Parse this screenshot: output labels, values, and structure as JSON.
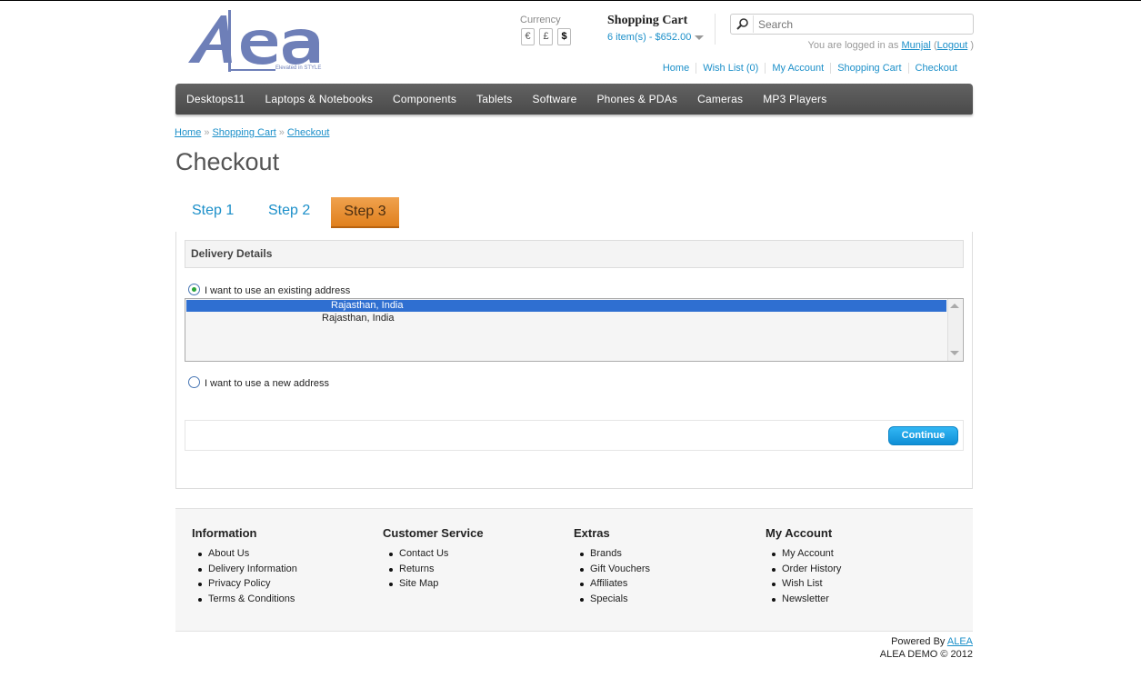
{
  "logo": {
    "text": "Aea",
    "tagline": "Elevated in STYLE"
  },
  "currency": {
    "label": "Currency",
    "options": [
      "€",
      "£",
      "$"
    ],
    "selected": "$"
  },
  "cart": {
    "title": "Shopping Cart",
    "summary": "6 item(s) - $652.00"
  },
  "search": {
    "placeholder": "Search"
  },
  "account": {
    "prefix": "You are logged in as",
    "user": "Munjal",
    "logout": "Logout",
    "open_paren": "(",
    "close_paren": ")"
  },
  "top_links": [
    "Home",
    "Wish List (0)",
    "My Account",
    "Shopping Cart",
    "Checkout"
  ],
  "menu": [
    "Desktops11",
    "Laptops & Notebooks",
    "Components",
    "Tablets",
    "Software",
    "Phones & PDAs",
    "Cameras",
    "MP3 Players"
  ],
  "breadcrumb": {
    "items": [
      "Home",
      "Shopping Cart",
      "Checkout"
    ],
    "separator": "»"
  },
  "page_title": "Checkout",
  "steps": [
    "Step 1",
    "Step 2",
    "Step 3"
  ],
  "active_step": "Step 3",
  "delivery": {
    "heading": "Delivery Details",
    "existing_label": "I want to use an existing address",
    "addresses": [
      "Rajasthan, India",
      "Rajasthan, India"
    ],
    "new_label": "I want to use a new address",
    "continue": "Continue"
  },
  "footer": {
    "columns": [
      {
        "title": "Information",
        "items": [
          "About Us",
          "Delivery Information",
          "Privacy Policy",
          "Terms & Conditions"
        ]
      },
      {
        "title": "Customer Service",
        "items": [
          "Contact Us",
          "Returns",
          "Site Map"
        ]
      },
      {
        "title": "Extras",
        "items": [
          "Brands",
          "Gift Vouchers",
          "Affiliates",
          "Specials"
        ]
      },
      {
        "title": "My Account",
        "items": [
          "My Account",
          "Order History",
          "Wish List",
          "Newsletter"
        ]
      }
    ],
    "powered_prefix": "Powered By",
    "powered_link": "ALEA",
    "copyright": "ALEA DEMO © 2012"
  },
  "colors": {
    "accent": "#1b8fc9",
    "step_active": "#e68a2a",
    "menu_bg": "#555555",
    "selected_row": "#2f6fd1"
  }
}
